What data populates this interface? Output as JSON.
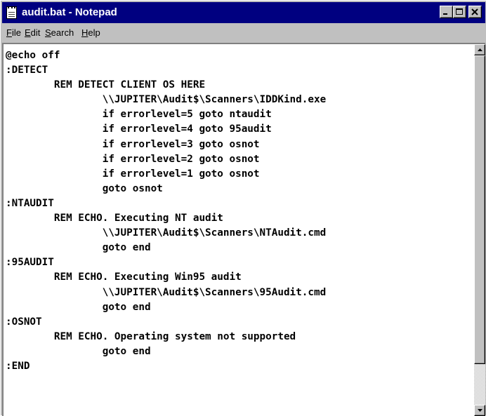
{
  "window": {
    "title": "audit.bat - Notepad",
    "icon": "notepad-icon",
    "controls": [
      "minimize-icon",
      "maximize-icon",
      "close-icon"
    ]
  },
  "menu": [
    {
      "accel": "F",
      "rest": "ile"
    },
    {
      "accel": "E",
      "rest": "dit"
    },
    {
      "accel": "S",
      "rest": "earch"
    },
    {
      "accel": "H",
      "rest": "elp"
    }
  ],
  "document": {
    "lines": [
      "@echo off",
      ":DETECT",
      "        REM DETECT CLIENT OS HERE",
      "                \\\\JUPITER\\Audit$\\Scanners\\IDDKind.exe",
      "                if errorlevel=5 goto ntaudit",
      "                if errorlevel=4 goto 95audit",
      "                if errorlevel=3 goto osnot",
      "                if errorlevel=2 goto osnot",
      "                if errorlevel=1 goto osnot",
      "                goto osnot",
      ":NTAUDIT",
      "        REM ECHO. Executing NT audit",
      "                \\\\JUPITER\\Audit$\\Scanners\\NTAudit.cmd",
      "                goto end",
      ":95AUDIT",
      "        REM ECHO. Executing Win95 audit",
      "                \\\\JUPITER\\Audit$\\Scanners\\95Audit.cmd",
      "                goto end",
      ":OSNOT",
      "        REM ECHO. Operating system not supported",
      "                goto end",
      ":END"
    ]
  },
  "scrollbar": {
    "up_icon": "arrow-up-icon",
    "down_icon": "arrow-down-icon"
  }
}
